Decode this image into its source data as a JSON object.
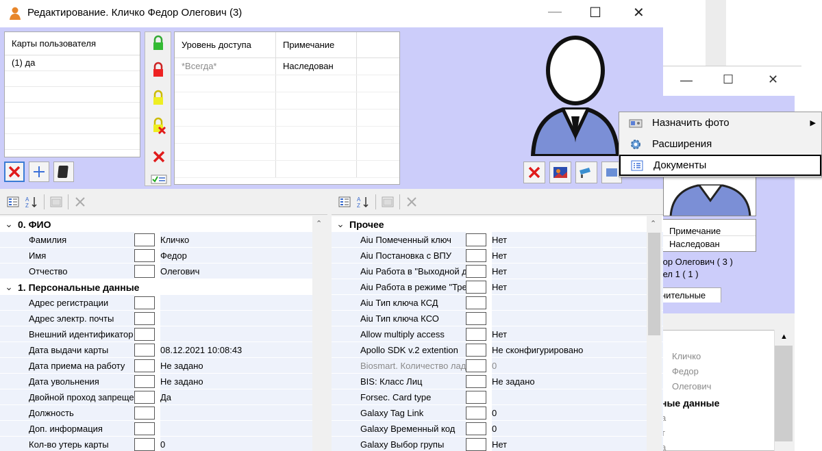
{
  "window": {
    "title": "Редактирование. Кличко Федор Олегович (3)",
    "minimize": "—",
    "maximize": "☐",
    "close": "✕"
  },
  "background_window": {
    "minimize": "—",
    "maximize": "☐",
    "close": "✕",
    "note_header": "Примечание",
    "note_value": "Наследован",
    "name_line": "дор Олегович ( 3 )",
    "dept_line": "дел 1 ( 1 )",
    "tab": "нительные",
    "field_values": [
      "Кличко",
      "Федор",
      "Олегович"
    ],
    "section": "ные данные",
    "side_letters": [
      "а",
      "т",
      "а"
    ]
  },
  "cards": {
    "header": "Карты пользователя",
    "rows": [
      "(1) да",
      "",
      "",
      "",
      "",
      ""
    ]
  },
  "access": {
    "columns": [
      "Уровень доступа",
      "Примечание"
    ],
    "rows": [
      {
        "level": "*Всегда*",
        "note": "Наследован"
      }
    ]
  },
  "context_menu": {
    "items": [
      {
        "label": "Назначить фото",
        "icon": "camera-icon",
        "submenu": true
      },
      {
        "label": "Расширения",
        "icon": "gear-icon",
        "submenu": false
      },
      {
        "label": "Документы",
        "icon": "document-list-icon",
        "submenu": false
      }
    ]
  },
  "left_grid": {
    "rows": [
      {
        "type": "cat",
        "label": "0. ФИО"
      },
      {
        "type": "prop",
        "label": "Фамилия",
        "value": "Кличко"
      },
      {
        "type": "prop",
        "label": "Имя",
        "value": "Федор"
      },
      {
        "type": "prop",
        "label": "Отчество",
        "value": "Олегович"
      },
      {
        "type": "cat",
        "label": "1. Персональные данные"
      },
      {
        "type": "prop",
        "label": "Адрес регистрации",
        "value": ""
      },
      {
        "type": "prop",
        "label": "Адрес электр. почты",
        "value": ""
      },
      {
        "type": "prop",
        "label": "Внешний идентификатор",
        "value": ""
      },
      {
        "type": "prop",
        "label": "Дата выдачи карты",
        "value": "08.12.2021 10:08:43"
      },
      {
        "type": "prop",
        "label": "Дата приема на работу",
        "value": "Не задано"
      },
      {
        "type": "prop",
        "label": "Дата увольнения",
        "value": "Не задано"
      },
      {
        "type": "prop",
        "label": "Двойной проход запреще",
        "value": "Да"
      },
      {
        "type": "prop",
        "label": "Должность",
        "value": ""
      },
      {
        "type": "prop",
        "label": "Доп. информация",
        "value": ""
      },
      {
        "type": "prop",
        "label": "Кол-во утерь карты",
        "value": "0"
      }
    ]
  },
  "right_grid": {
    "rows": [
      {
        "type": "cat",
        "label": "Прочее"
      },
      {
        "type": "prop",
        "label": "Aiu Помеченный ключ",
        "value": "Нет"
      },
      {
        "type": "prop",
        "label": "Aiu Постановка с ВПУ",
        "value": "Нет"
      },
      {
        "type": "prop",
        "label": "Aiu Работа в \"Выходной дє",
        "value": "Нет"
      },
      {
        "type": "prop",
        "label": "Aiu Работа в режиме \"Тре",
        "value": "Нет"
      },
      {
        "type": "prop",
        "label": "Aiu Тип ключа КСД",
        "value": ""
      },
      {
        "type": "prop",
        "label": "Aiu Тип ключа КСО",
        "value": ""
      },
      {
        "type": "prop",
        "label": "Allow multiply access",
        "value": "Нет"
      },
      {
        "type": "prop",
        "label": "Apollo SDK v.2 extention",
        "value": "Не сконфигурировано"
      },
      {
        "type": "prop",
        "label": "Biosmart. Количество ладо",
        "value": "0",
        "gray": true
      },
      {
        "type": "prop",
        "label": "BIS: Класс Лиц",
        "value": "Не задано"
      },
      {
        "type": "prop",
        "label": "Forsec. Card type",
        "value": ""
      },
      {
        "type": "prop",
        "label": "Galaxy Tag Link",
        "value": "0"
      },
      {
        "type": "prop",
        "label": "Galaxy Временный код",
        "value": "0"
      },
      {
        "type": "prop",
        "label": "Galaxy Выбор групы",
        "value": "Нет"
      }
    ]
  },
  "toolbar": {
    "categorized": "categorized-icon",
    "sort_az": "sort-az-icon",
    "pages": "property-pages-icon",
    "delete": "delete-icon"
  },
  "colors": {
    "panel_lilac": "#cccdfa",
    "row_tint": "#eef2fb",
    "red": "#e01b1b",
    "accent_blue": "#4a6bd6"
  }
}
